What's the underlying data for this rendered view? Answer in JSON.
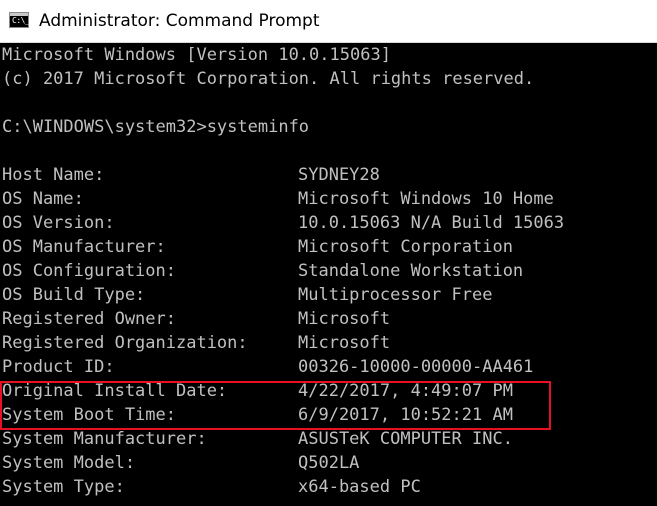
{
  "window": {
    "title": "Administrator: Command Prompt",
    "icon": "cmd-icon",
    "icon_glyph": "C:\\_"
  },
  "console": {
    "header_lines": [
      "Microsoft Windows [Version 10.0.15063]",
      "(c) 2017 Microsoft Corporation. All rights reserved."
    ],
    "command": "C:\\WINDOWS\\system32>systeminfo",
    "rows": [
      {
        "label": "Host Name:",
        "value": "SYDNEY28"
      },
      {
        "label": "OS Name:",
        "value": "Microsoft Windows 10 Home"
      },
      {
        "label": "OS Version:",
        "value": "10.0.15063 N/A Build 15063"
      },
      {
        "label": "OS Manufacturer:",
        "value": "Microsoft Corporation"
      },
      {
        "label": "OS Configuration:",
        "value": "Standalone Workstation"
      },
      {
        "label": "OS Build Type:",
        "value": "Multiprocessor Free"
      },
      {
        "label": "Registered Owner:",
        "value": "Microsoft"
      },
      {
        "label": "Registered Organization:",
        "value": "Microsoft"
      },
      {
        "label": "Product ID:",
        "value": "00326-10000-00000-AA461"
      },
      {
        "label": "Original Install Date:",
        "value": "4/22/2017, 4:49:07 PM"
      },
      {
        "label": "System Boot Time:",
        "value": "6/9/2017, 10:52:21 AM"
      },
      {
        "label": "System Manufacturer:",
        "value": "ASUSTeK COMPUTER INC."
      },
      {
        "label": "System Model:",
        "value": "Q502LA"
      },
      {
        "label": "System Type:",
        "value": "x64-based PC"
      }
    ]
  },
  "colors": {
    "console_background": "#000000",
    "console_text": "#c0c0c0",
    "highlight_border": "#e81123",
    "titlebar_background": "#ffffff"
  }
}
